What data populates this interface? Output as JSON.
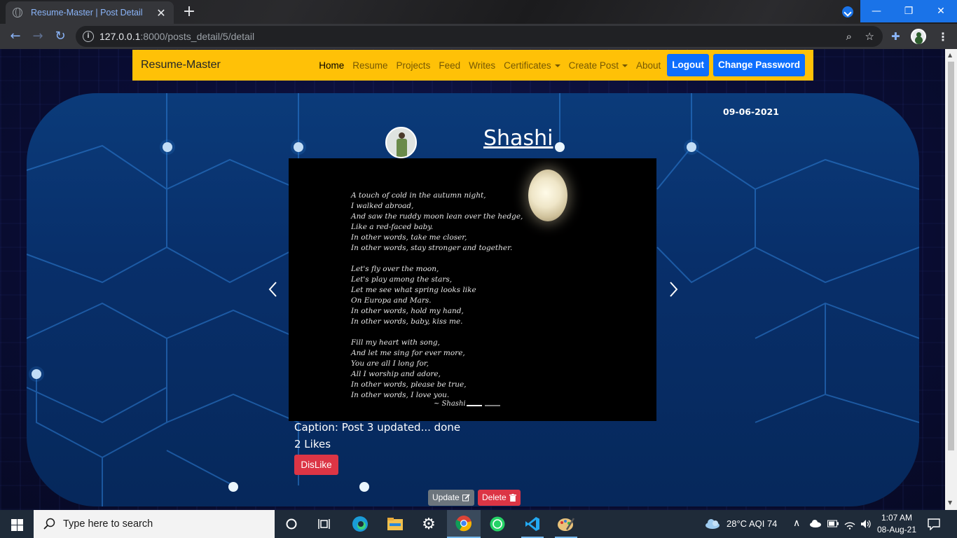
{
  "browser": {
    "tab_title": "Resume-Master | Post Detail",
    "url_host": "127.0.0.1",
    "url_rest": ":8000/posts_detail/5/detail"
  },
  "navbar": {
    "brand": "Resume-Master",
    "links": [
      "Home",
      "Resume",
      "Projects",
      "Feed",
      "Writes",
      "Certificates",
      "Create Post",
      "About"
    ],
    "logout": "Logout",
    "change_password": "Change Password"
  },
  "post": {
    "date": "09-06-2021",
    "author": "Shashi",
    "caption": "Caption: Post 3 updated... done",
    "likes": "2 Likes",
    "dislike": "DisLike",
    "update": "Update",
    "delete": "Delete",
    "poem": "A touch of cold in the autumn night,\nI walked abroad,\nAnd saw the ruddy moon lean over the hedge,\nLike a red-faced baby.\nIn other words, take me closer,\nIn other words, stay stronger and together.\n\nLet's fly over the moon,\nLet's play among the stars,\nLet me see what spring looks like\nOn Europa and Mars.\nIn other words, hold my hand,\nIn other words, baby, kiss me.\n\nFill my heart with song,\nAnd let me sing for ever more,\nYou are all I long for,\nAll I worship and adore,\nIn other words, please be true,\nIn other words, I love you.",
    "signature": "~ Shashi"
  },
  "taskbar": {
    "search_placeholder": "Type here to search",
    "weather": "28°C  AQI 74",
    "time": "1:07 AM",
    "date": "08-Aug-21"
  },
  "colors": {
    "navbar": "#ffc107",
    "primary": "#0d6efd",
    "danger": "#dc3545",
    "secondary": "#6c757d"
  }
}
